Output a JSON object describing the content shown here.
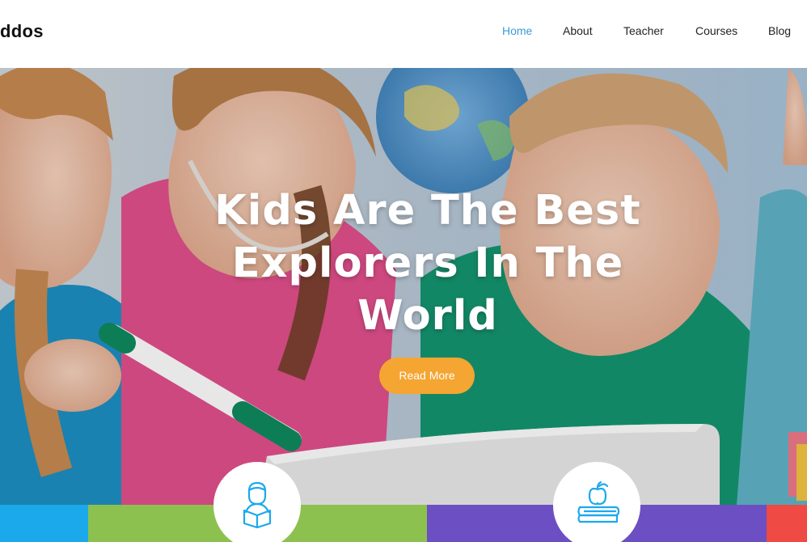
{
  "header": {
    "logo": "ddos",
    "nav": [
      {
        "label": "Home",
        "active": true
      },
      {
        "label": "About",
        "active": false
      },
      {
        "label": "Teacher",
        "active": false
      },
      {
        "label": "Courses",
        "active": false
      },
      {
        "label": "Blog",
        "active": false
      }
    ]
  },
  "hero": {
    "title_line1": "Kids Are The Best",
    "title_line2": "Explorers In The",
    "title_line3": "World",
    "button_label": "Read More"
  },
  "features": [
    {
      "icon": "reading-student-icon"
    },
    {
      "icon": "apple-books-icon"
    }
  ],
  "colors": {
    "nav_active": "#3a9ad9",
    "button": "#f5a531",
    "strip_blue": "#1ba9ec",
    "strip_green": "#8dc14f",
    "strip_purple": "#6c4fc3",
    "strip_red": "#ef4a43",
    "icon_blue": "#1ba9ec"
  }
}
